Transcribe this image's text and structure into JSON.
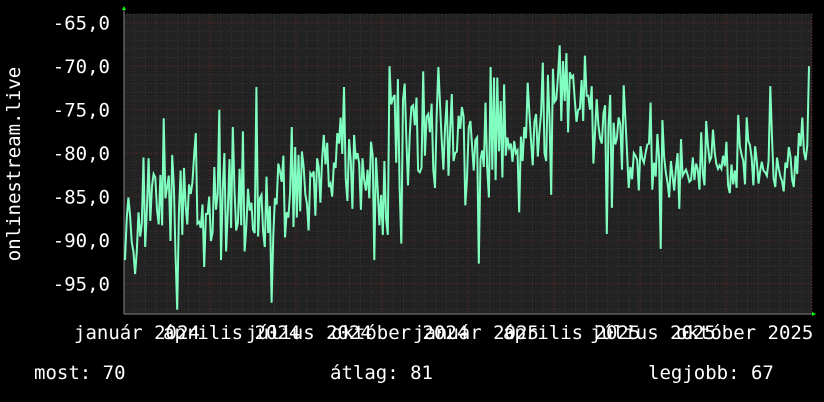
{
  "chart_data": {
    "type": "line",
    "ylabel": "onlinestream.live",
    "y_ticks": [
      "-65,0",
      "-70,0",
      "-75,0",
      "-80,0",
      "-85,0",
      "-90,0",
      "-95,0"
    ],
    "y_tick_values": [
      -65,
      -70,
      -75,
      -80,
      -85,
      -90,
      -95
    ],
    "ylim": [
      -98.5,
      -64
    ],
    "x_tick_labels": [
      "január 2024",
      "április 2024",
      "július 2024",
      "október 2024",
      "január 2025",
      "április 2025",
      "július 2025",
      "október 2025"
    ],
    "grid": true,
    "series": [
      {
        "color": "#80ffc0",
        "y": [
          -92.3,
          -87.6,
          -85.1,
          -87.2,
          -90.2,
          -91.3,
          -93.9,
          -91.3,
          -86.8,
          -89.6,
          -88.1,
          -80.5,
          -90.8,
          -86.4,
          -80.6,
          -87.8,
          -83.8,
          -82.4,
          -82.8,
          -86.5,
          -88.2,
          -82.5,
          -88.3,
          -76.0,
          -85.2,
          -83.9,
          -82.6,
          -90.1,
          -80.2,
          -83.9,
          -91.6,
          -98.0,
          -87.0,
          -82.0,
          -89.4,
          -81.7,
          -86.2,
          -88.2,
          -83.6,
          -84.7,
          -83.4,
          -80.3,
          -77.7,
          -88.1,
          -87.9,
          -88.6,
          -85.9,
          -93.1,
          -87.0,
          -87.0,
          -85.0,
          -90.1,
          -89.1,
          -81.6,
          -86.5,
          -84.7,
          -75.0,
          -92.3,
          -84.3,
          -80.0,
          -91.3,
          -86.8,
          -80.7,
          -88.6,
          -77.0,
          -84.2,
          -88.9,
          -88.0,
          -81.8,
          -88.3,
          -77.5,
          -91.3,
          -88.5,
          -84.1,
          -86.6,
          -85.7,
          -88.8,
          -89.2,
          -72.4,
          -89.6,
          -85.2,
          -84.8,
          -89.0,
          -90.8,
          -82.7,
          -89.2,
          -86.1,
          -97.2,
          -89.4,
          -85.2,
          -85.9,
          -81.2,
          -82.1,
          -83.3,
          -80.3,
          -89.7,
          -86.8,
          -87.4,
          -84.5,
          -77.0,
          -88.5,
          -79.3,
          -87.4,
          -80.2,
          -86.7,
          -79.8,
          -81.5,
          -84.7,
          -85.9,
          -88.9,
          -82.3,
          -82.6,
          -82.1,
          -87.2,
          -80.6,
          -81.6,
          -85.7,
          -80.7,
          -77.9,
          -81.3,
          -78.8,
          -83.9,
          -83.5,
          -85.0,
          -81.1,
          -81.7,
          -77.7,
          -78.9,
          -75.9,
          -80.1,
          -72.4,
          -82.9,
          -85.5,
          -78.4,
          -80.9,
          -86.4,
          -77.9,
          -80.7,
          -80.0,
          -81.2,
          -86.5,
          -80.6,
          -83.1,
          -84.3,
          -81.9,
          -85.2,
          -78.7,
          -80.3,
          -92.3,
          -80.5,
          -84.2,
          -88.3,
          -84.8,
          -89.4,
          -80.9,
          -87.6,
          -89.4,
          -70.0,
          -74.4,
          -73.7,
          -73.3,
          -81.1,
          -71.5,
          -83.9,
          -90.4,
          -73.9,
          -72.0,
          -78.2,
          -83.7,
          -78.0,
          -74.7,
          -74.5,
          -76.8,
          -73.6,
          -82.0,
          -82.2,
          -81.7,
          -70.6,
          -80.3,
          -75.8,
          -75.5,
          -77.6,
          -74.3,
          -81.9,
          -84.0,
          -75.6,
          -70.1,
          -74.3,
          -78.5,
          -81.9,
          -76.9,
          -73.9,
          -82.6,
          -77.2,
          -73.2,
          -80.9,
          -80.0,
          -79.8,
          -75.7,
          -77.2,
          -74.7,
          -75.8,
          -86.0,
          -82.9,
          -77.1,
          -76.3,
          -79.2,
          -82.0,
          -78.5,
          -78.2,
          -92.7,
          -80.7,
          -79.7,
          -81.6,
          -74.2,
          -81.7,
          -85.1,
          -70.1,
          -81.9,
          -71.3,
          -83.1,
          -71.3,
          -79.8,
          -74.0,
          -82.8,
          -72.1,
          -80.3,
          -78.2,
          -79.4,
          -78.9,
          -81.0,
          -78.6,
          -80.0,
          -79.7,
          -86.8,
          -78.1,
          -80.9,
          -77.0,
          -78.3,
          -71.9,
          -75.2,
          -78.5,
          -81.4,
          -76.4,
          -75.5,
          -80.4,
          -77.6,
          -75.4,
          -69.6,
          -80.0,
          -80.9,
          -71.0,
          -76.3,
          -84.8,
          -70.3,
          -74.1,
          -73.8,
          -71.2,
          -67.6,
          -76.3,
          -69.4,
          -74.0,
          -68.5,
          -77.6,
          -70.7,
          -71.3,
          -71.1,
          -73.9,
          -76.4,
          -75.0,
          -74.9,
          -71.6,
          -76.3,
          -68.8,
          -73.4,
          -73.4,
          -75.0,
          -72.3,
          -81.2,
          -77.7,
          -73.8,
          -76.8,
          -78.3,
          -78.9,
          -75.4,
          -74.5,
          -89.3,
          -76.9,
          -73.3,
          -86.3,
          -76.5,
          -79.0,
          -78.3,
          -75.9,
          -76.7,
          -81.9,
          -72.2,
          -76.1,
          -79.8,
          -84.0,
          -81.6,
          -83.0,
          -80.0,
          -80.3,
          -80.8,
          -84.3,
          -79.2,
          -80.6,
          -81.1,
          -80.0,
          -79.0,
          -78.9,
          -74.2,
          -84.2,
          -81.1,
          -82.7,
          -77.8,
          -80.6,
          -91.0,
          -76.2,
          -80.4,
          -82.2,
          -83.4,
          -85.1,
          -80.9,
          -82.6,
          -84.3,
          -81.8,
          -80.0,
          -86.4,
          -78.4,
          -82.6,
          -82.2,
          -81.9,
          -82.5,
          -83.3,
          -83.1,
          -80.5,
          -83.1,
          -81.2,
          -81.9,
          -84.2,
          -77.6,
          -82.4,
          -83.7,
          -76.3,
          -79.1,
          -80.9,
          -80.5,
          -77.3,
          -79.9,
          -81.2,
          -81.8,
          -81.4,
          -81.8,
          -80.3,
          -81.5,
          -78.7,
          -83.7,
          -84.6,
          -81.3,
          -83.6,
          -82.0,
          -84.0,
          -75.6,
          -79.2,
          -80.2,
          -80.9,
          -83.6,
          -75.9,
          -78.6,
          -79.1,
          -80.6,
          -83.7,
          -79.2,
          -80.9,
          -83.5,
          -82.1,
          -81.0,
          -82.0,
          -82.2,
          -82.6,
          -80.9,
          -72.3,
          -77.9,
          -82.9,
          -83.9,
          -80.5,
          -81.8,
          -82.7,
          -83.2,
          -84.4,
          -81.1,
          -81.7,
          -79.3,
          -80.4,
          -83.1,
          -83.9,
          -80.3,
          -82.4,
          -77.7,
          -79.2,
          -75.9,
          -79.8,
          -80.8,
          -79.1,
          -70.0
        ]
      }
    ]
  },
  "stats": {
    "now_label": "most: 70",
    "avg_label": "átlag: 81",
    "best_label": "legjobb: 67"
  }
}
